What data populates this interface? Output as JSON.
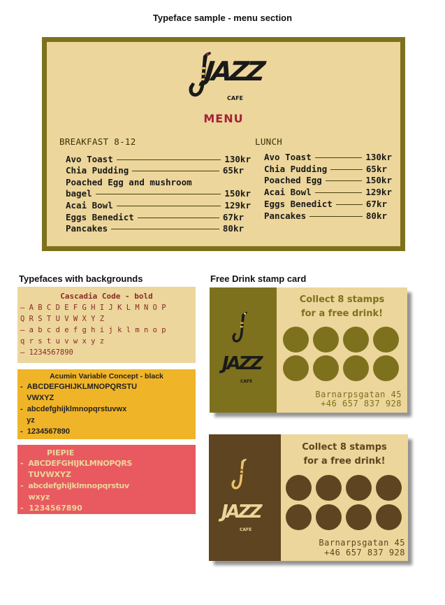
{
  "page_title": "Typeface sample -  menu section",
  "menu": {
    "logo_word": "JAZZ",
    "logo_sub": "CAFE",
    "heading": "MENU",
    "breakfast": {
      "title": "BREAKFAST 8-12",
      "items": [
        {
          "name": "Avo Toast",
          "price": "130kr"
        },
        {
          "name": "Chia Pudding",
          "price": "65kr"
        },
        {
          "name_line1": "Poached Egg and mushroom",
          "name": "bagel",
          "price": "150kr"
        },
        {
          "name": "Acai Bowl",
          "price": "129kr"
        },
        {
          "name": "Eggs Benedict",
          "price": "67kr"
        },
        {
          "name": "Pancakes",
          "price": "80kr"
        }
      ]
    },
    "lunch": {
      "title": "LUNCH",
      "items": [
        {
          "name": "Avo Toast",
          "price": "130kr"
        },
        {
          "name": "Chia Pudding",
          "price": "65kr"
        },
        {
          "name": "Poached Egg",
          "price": "150kr"
        },
        {
          "name": "Acai Bowl",
          "price": "129kr"
        },
        {
          "name": "Eggs Benedict",
          "price": "67kr"
        },
        {
          "name": "Pancakes",
          "price": "80kr"
        }
      ]
    }
  },
  "typefaces": {
    "heading": "Typefaces with backgrounds",
    "swatches": [
      {
        "title": "Cascadia Code - bold",
        "lines": [
          "– A B C D E F G H I J K L M N O P",
          "  Q R S T U V W X Y Z",
          "– a b c d e f g h i j k l m n o p",
          "  q r s t u v w x y z",
          "– 1234567890"
        ],
        "background": "#ecd69b",
        "color": "#8a2a2a"
      },
      {
        "title": "Acumin Variable Concept - black",
        "lines": [
          "-  ABCDEFGHIJKLMNOPQRSTU",
          "   VWXYZ",
          "-  abcdefghijklmnopqrstuvwx",
          "   yz",
          "-  1234567890"
        ],
        "background": "#f0b428",
        "color": "#222222"
      },
      {
        "title": "PIEPIE",
        "lines": [
          "-  ABCDEFGHIJKLMNOPQRS",
          "   TUVWXYZ",
          "-  abcdefghijklmnopqrstuv",
          "   wxyz",
          "-  1234567890"
        ],
        "background": "#e85a60",
        "color": "#ecd69b"
      }
    ]
  },
  "stamp_cards": {
    "heading": "Free Drink stamp card",
    "cards": [
      {
        "collect_line1": "Collect 8 stamps",
        "collect_line2": "for a free drink!",
        "logo_word": "JAZZ",
        "logo_sub": "CAFE",
        "address": "Barnarpsgatan 45",
        "phone": "+46 657 837 928",
        "stamps": 8,
        "left_color": "#7d711d",
        "right_color": "#ecd69b",
        "stamp_color": "#7d711d",
        "text_color": "#7d711d"
      },
      {
        "collect_line1": "Collect 8 stamps",
        "collect_line2": "for a free drink!",
        "logo_word": "JAZZ",
        "logo_sub": "CAFE",
        "address": "Barnarpsgatan 45",
        "phone": "+46 657 837 928",
        "stamps": 8,
        "left_color": "#5e4420",
        "right_color": "#ecd69b",
        "stamp_color": "#5e4420",
        "text_color": "#5e4420"
      }
    ]
  },
  "colors": {
    "olive": "#7d711d",
    "cream": "#ecd69b",
    "menu_red": "#a3223a",
    "brown": "#5e4420"
  }
}
